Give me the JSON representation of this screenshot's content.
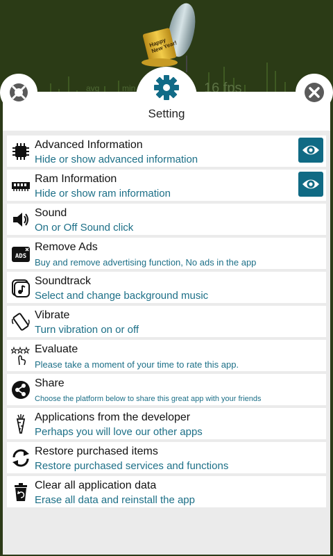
{
  "background": {
    "labels": [
      "avg",
      "min"
    ],
    "fps": "16 fps",
    "hat_text": "Happy New Year!"
  },
  "header": {
    "title": "Setting"
  },
  "colors": {
    "accent": "#1c6f87",
    "eye_button": "#106a84",
    "panel_bg": "#ebebeb"
  },
  "items": [
    {
      "label": "Advanced Information",
      "desc": "Hide or show advanced information",
      "icon": "chip-icon",
      "has_eye": true
    },
    {
      "label": "Ram Information",
      "desc": "Hide or show ram information",
      "icon": "ram-icon",
      "has_eye": true
    },
    {
      "label": "Sound",
      "desc": "On or Off Sound click",
      "icon": "speaker-icon",
      "has_eye": false
    },
    {
      "label": "Remove Ads",
      "desc": "Buy and remove advertising function, No ads in the app",
      "icon": "ads-icon",
      "has_eye": false
    },
    {
      "label": "Soundtrack",
      "desc": "Select and change background music",
      "icon": "music-note-icon",
      "has_eye": false
    },
    {
      "label": "Vibrate",
      "desc": "Turn vibration on or off",
      "icon": "vibrate-phone-icon",
      "has_eye": false
    },
    {
      "label": "Evaluate",
      "desc": "Please take a moment of your time to rate this app.",
      "icon": "rate-stars-icon",
      "has_eye": false
    },
    {
      "label": "Share",
      "desc": "Choose the platform below to share this great app with your friends",
      "icon": "share-icon",
      "has_eye": false
    },
    {
      "label": "Applications from the developer",
      "desc": "Perhaps you will love our other apps",
      "icon": "carrot-icon",
      "has_eye": false
    },
    {
      "label": "Restore purchased items",
      "desc": "Restore purchased services and functions",
      "icon": "restore-icon",
      "has_eye": false
    },
    {
      "label": "Clear all application data",
      "desc": "Erase all data and reinstall the app",
      "icon": "trash-icon",
      "has_eye": false
    }
  ]
}
